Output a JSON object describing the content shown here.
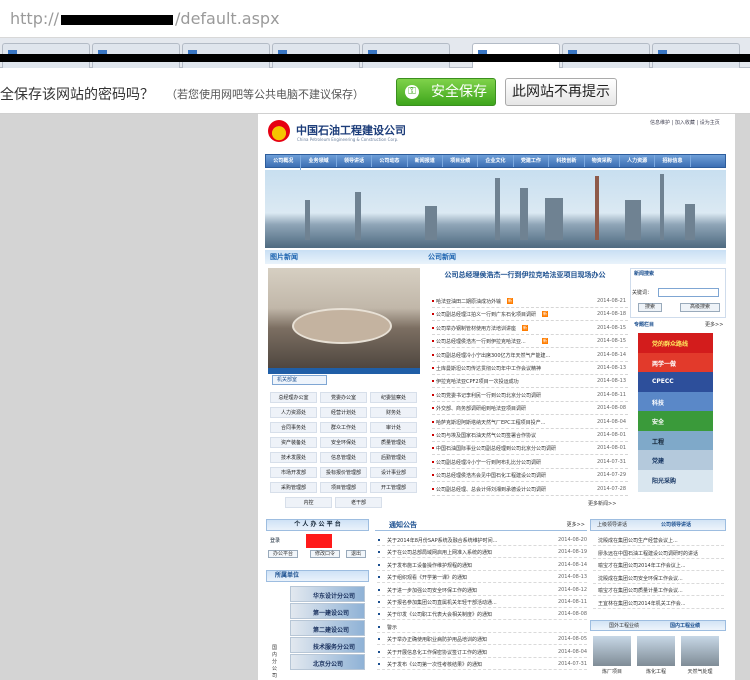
{
  "browser": {
    "url_prefix": "http://",
    "url_suffix": "/default.aspx"
  },
  "password_bar": {
    "question": "全保存该网站的密码吗？",
    "hint": "（若您使用网吧等公共电脑不建议保存）",
    "save_label": "安全保存",
    "never_label": "此网站不再提示"
  },
  "site": {
    "company_name": "中国石油工程建设公司",
    "company_name_en": "China Petroleum Engineering & Construction Corp.",
    "top_links": "信息维护 | 加入收藏 | 设为主页",
    "nav": [
      "公司概况",
      "业务领域",
      "领导讲话",
      "公司动态",
      "新闻报道",
      "项目业绩",
      "企业文化",
      "党建工作",
      "科技创新",
      "物资采购",
      "人力资源",
      "招标信息",
      "联系我们"
    ],
    "section_photo_news": "图片新闻",
    "section_company_news": "公司新闻",
    "dept_title": "机关部室",
    "depts": [
      [
        "总经理办公室",
        "党委办公室",
        "纪委监察处"
      ],
      [
        "人力资源处",
        "经营计划处",
        "财务处"
      ],
      [
        "合同事务处",
        "群众工作处",
        "审计处"
      ],
      [
        "资产装备处",
        "安全环保处",
        "质量管理处"
      ],
      [
        "技术发展处",
        "信息管理处",
        "后勤管理处"
      ],
      [
        "市场开发部",
        "投标报价管理部",
        "设计事业部"
      ],
      [
        "采购管理部",
        "项目管理部",
        "开工管理部"
      ],
      [
        "内控",
        "老干部"
      ]
    ],
    "headline": "公司总经理侯浩杰一行到伊拉克哈法亚项目现场办公",
    "news": [
      {
        "t": "哈法亚油田二期原油成功外输",
        "d": "2014-08-21",
        "new": "新"
      },
      {
        "t": "公司副总经理江拍义一行到广东石化项目调研",
        "d": "2014-08-18",
        "new": "新"
      },
      {
        "t": "公司举办钢制管材使用方法培训讲座",
        "d": "2014-08-15",
        "new": "新"
      },
      {
        "t": "公司总经理侯浩杰一行到伊拉克哈法亚...",
        "d": "2014-08-15",
        "new": "新"
      },
      {
        "t": "公司副总经理冷小宁出席300亿方年天然气产能建...",
        "d": "2014-08-14",
        "new": ""
      },
      {
        "t": "土库曼斯坦公司传达贯彻公司年中工作会议精神",
        "d": "2014-08-13",
        "new": ""
      },
      {
        "t": "伊拉克哈法亚CPF2项目一次投运成功",
        "d": "2014-08-13",
        "new": ""
      },
      {
        "t": "公司党委书记李利民一行到公司北京分公司调研",
        "d": "2014-08-11",
        "new": ""
      },
      {
        "t": "外交部、商务部调研组到哈法亚项目调研",
        "d": "2014-08-08",
        "new": ""
      },
      {
        "t": "哈萨克斯坦阿斯塔纳天然气厂EPC工程项目投产...",
        "d": "2014-08-04",
        "new": ""
      },
      {
        "t": "公司与埃及国家石油天然气公司签署合作协议",
        "d": "2014-08-01",
        "new": ""
      },
      {
        "t": "中国石油国际事业公司副总经理到公司北京分公司调研",
        "d": "2014-08-01",
        "new": ""
      },
      {
        "t": "公司副总经理冷小宁一行到阿布扎比分公司调研",
        "d": "2014-07-31",
        "new": ""
      },
      {
        "t": "公司总经理侯浩杰会见中国石化工程建设公司调研",
        "d": "2014-07-29",
        "new": ""
      },
      {
        "t": "公司副总经理、总会计师刘湘到承德设计公司调研",
        "d": "2014-07-28",
        "new": ""
      }
    ],
    "news_more": "更多新闻>>",
    "search_title": "新闻搜索",
    "search_label": "关键词：",
    "search_btn": "搜索",
    "adv_search_btn": "高级搜索",
    "topic_title": "专题栏目",
    "more": "更多>>",
    "topics": [
      {
        "label": "党的群众路线",
        "bg": "#d31c1c",
        "fg": "#ffe65c"
      },
      {
        "label": "两学一做",
        "bg": "#e23a2b",
        "fg": "#fff"
      },
      {
        "label": "CPECC",
        "bg": "#2d4f9b",
        "fg": "#fff"
      },
      {
        "label": "科技",
        "bg": "#5a88c8",
        "fg": "#fff"
      },
      {
        "label": "安全",
        "bg": "#3a9a3a",
        "fg": "#fff"
      },
      {
        "label": "工程",
        "bg": "#7fa9c9",
        "fg": "#123"
      },
      {
        "label": "党建",
        "bg": "#b4c9dc",
        "fg": "#1b3a66"
      },
      {
        "label": "阳光采购",
        "bg": "#d9e6ef",
        "fg": "#1b3a66"
      }
    ],
    "office_title": "个 人 办 公 平 台",
    "login_label": "登录",
    "office_btns": [
      "办公平台",
      "修改口令",
      "退出"
    ],
    "units_title": "所属单位",
    "units": [
      "华东设计分公司",
      "第一建设公司",
      "第二建设公司",
      "技术服务分公司",
      "北京分公司"
    ],
    "units_side": "国内分公司",
    "notice_title": "通知公告",
    "notices": [
      {
        "t": "关于2014年8月份SAP系统及融合系统维护时间...",
        "d": "2014-08-20"
      },
      {
        "t": "关于在公司总部局域网启用上网准入系统的通知",
        "d": "2014-08-19"
      },
      {
        "t": "关于发布施工设备操作维护规程的通知",
        "d": "2014-08-14"
      },
      {
        "t": "关于组织观看《开学第一课》的通知",
        "d": "2014-08-13"
      },
      {
        "t": "关于进一步加强公司安全环保工作的通知",
        "d": "2014-08-12"
      },
      {
        "t": "关于报名参加集团公司直属机关年轻干部活动通...",
        "d": "2014-08-11"
      },
      {
        "t": "关于印发《公司职工代表大会相关制度》的通知",
        "d": "2014-08-08"
      },
      {
        "t": "警示",
        "d": ""
      },
      {
        "t": "关于举办正确使用职业病防护用品培训的通知",
        "d": "2014-08-05"
      },
      {
        "t": "关于开展信息化工作保密协议签订工作的通知",
        "d": "2014-08-04"
      },
      {
        "t": "关于发布《公司第一次性考核结果》的通知",
        "d": "2014-07-31"
      }
    ],
    "rb_tab_a": "上级领导讲话",
    "rb_tab_b": "公司领导讲话",
    "rb_rows": [
      "沈殿成在集团公司生产经营会议上...",
      "廖永远在中国石油工程建设公司调研时的讲话",
      "喻宝才在集团公司2014年工作会议上...",
      "沈殿成在集团公司安全环保工作会议...",
      "喻宝才在集团公司质量计量工作会议...",
      "王宜林在集团公司2014年机关工作会..."
    ],
    "proj_tab_a": "国外工程业绩",
    "proj_tab_b": "国内工程业绩",
    "projects": [
      "炼厂项目",
      "炼化工程",
      "天然气处理"
    ]
  }
}
